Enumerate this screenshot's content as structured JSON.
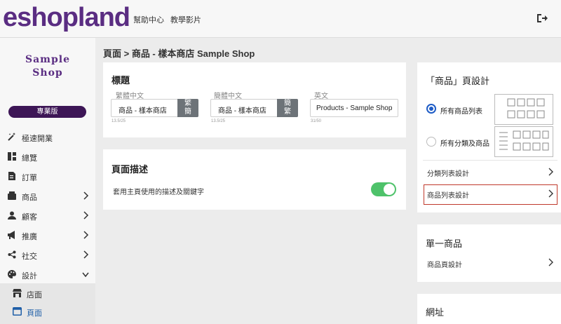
{
  "header": {
    "logo": "eshopland",
    "links": [
      "幫助中心",
      "教學影片"
    ],
    "logout_icon": "logout-icon"
  },
  "sidebar": {
    "shop_logo_line1": "Sample",
    "shop_logo_line2": "Shop",
    "plan_badge": "專業版",
    "items": [
      {
        "label": "極速開業",
        "icon": "magic-wand-icon"
      },
      {
        "label": "總覽",
        "icon": "dashboard-icon"
      },
      {
        "label": "訂單",
        "icon": "order-icon"
      },
      {
        "label": "商品",
        "icon": "product-icon"
      },
      {
        "label": "顧客",
        "icon": "customer-icon"
      },
      {
        "label": "推廣",
        "icon": "megaphone-icon"
      },
      {
        "label": "社交",
        "icon": "share-icon"
      },
      {
        "label": "設計",
        "icon": "palette-icon"
      }
    ],
    "sub_items": [
      {
        "label": "店面",
        "icon": "store-icon"
      },
      {
        "label": "頁面",
        "icon": "page-icon",
        "active": true
      }
    ]
  },
  "breadcrumb": "頁面 > 商品 - 樣本商店 Sample Shop",
  "title_card": {
    "title": "標題",
    "fields": [
      {
        "label": "繁體中文",
        "value": "商品 - 樣本商店",
        "button_top": "繁",
        "button_bottom": "簡",
        "counter": "13.5/25"
      },
      {
        "label": "簡體中文",
        "value": "商品 - 樣本商店",
        "button_top": "簡",
        "button_bottom": "繁",
        "counter": "13.5/25"
      },
      {
        "label": "英文",
        "value": "Products - Sample Shop",
        "counter": "31/50"
      }
    ]
  },
  "desc_card": {
    "title": "頁面描述",
    "toggle_label": "套用主頁使用的描述及關鍵字",
    "toggle_on": true
  },
  "design_card": {
    "title": "「商品」頁設計",
    "options": [
      {
        "label": "所有商品列表",
        "selected": true
      },
      {
        "label": "所有分類及商品",
        "selected": false
      }
    ],
    "links": [
      "分類列表設計",
      "商品列表設計"
    ]
  },
  "single_card": {
    "title": "單一商品",
    "link": "商品頁設計"
  },
  "url_card": {
    "title": "網址"
  },
  "colors": {
    "brand": "#5a2d82",
    "badge": "#3d1656",
    "toggle_on": "#4ec26a",
    "radio_selected": "#1e5cc6",
    "highlight": "#c0392b",
    "active_nav": "#1f5fa8"
  }
}
